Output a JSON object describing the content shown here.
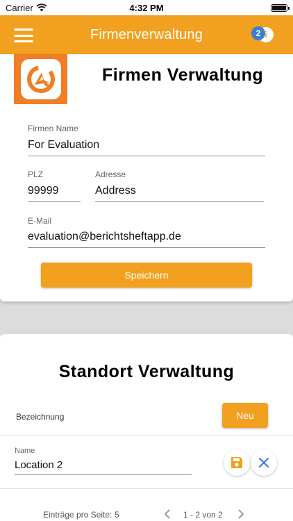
{
  "status_bar": {
    "carrier": "Carrier",
    "time": "4:32 PM"
  },
  "app_bar": {
    "title": "Firmenverwaltung",
    "notification_count": "2",
    "info_glyph": "i"
  },
  "company": {
    "heading": "Firmen Verwaltung",
    "name_label": "Firmen Name",
    "name_value": "For Evaluation",
    "plz_label": "PLZ",
    "plz_value": "99999",
    "address_label": "Adresse",
    "address_value": "Address",
    "email_label": "E-Mail",
    "email_value": "evaluation@berichtsheftapp.de",
    "save_label": "Speichern"
  },
  "locations": {
    "heading": "Standort Verwaltung",
    "column_header": "Bezeichnung",
    "new_label": "Neu",
    "rows": [
      {
        "name_label": "Name",
        "name_value": "Location 2"
      }
    ],
    "pagination": {
      "per_page_label": "Einträge pro Seite:",
      "per_page_value": "5",
      "range": "1 - 2 von 2"
    }
  },
  "colors": {
    "accent": "#f2a01f",
    "logo_bg": "#ef7e25",
    "badge": "#3a7fd5",
    "close_icon": "#3a7fd5"
  },
  "icons": [
    "wifi-icon",
    "battery-icon",
    "menu-icon",
    "info-icon",
    "app-logo",
    "save-icon",
    "close-icon",
    "chevron-left-icon",
    "chevron-right-icon"
  ]
}
